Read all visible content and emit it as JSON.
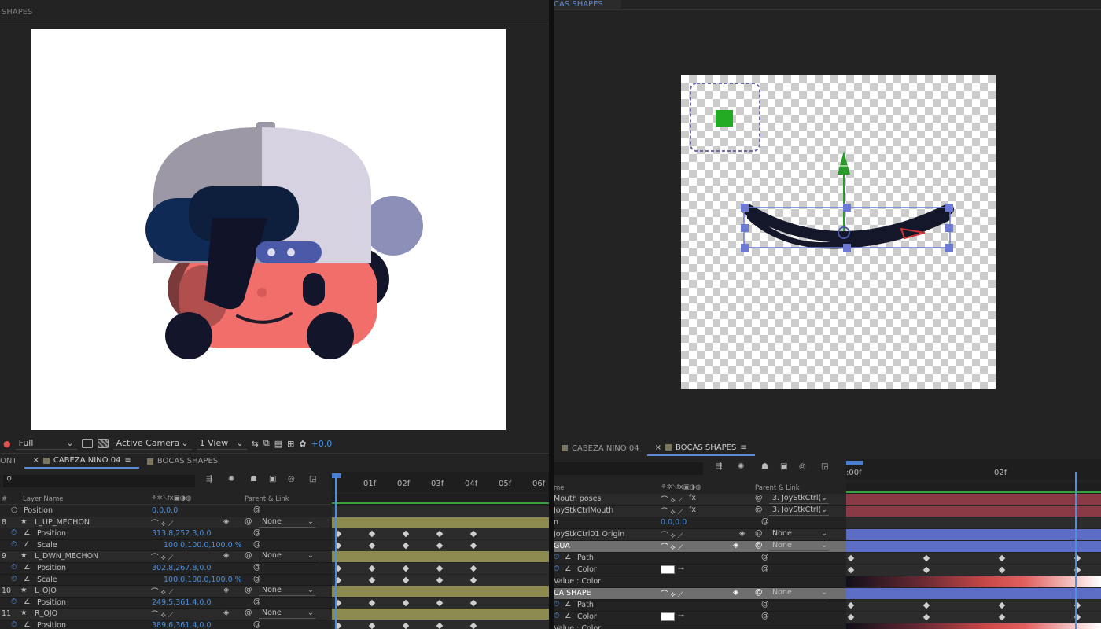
{
  "left_panel": {
    "title": "SHAPES",
    "viewer": {
      "resolution": "Full",
      "camera": "Active Camera",
      "views": "1 View",
      "exposure": "+0.0"
    },
    "tabs": [
      {
        "label": "ONT"
      },
      {
        "label": "CABEZA NINO 04"
      },
      {
        "label": "BOCAS SHAPES"
      }
    ],
    "search_placeholder": "",
    "headers": {
      "num": "#",
      "layer_name": "Layer Name",
      "parent": "Parent & Link"
    },
    "ruler": [
      "01f",
      "02f",
      "03f",
      "04f",
      "05f",
      "06f"
    ],
    "rows": [
      {
        "num": "",
        "name": "Position",
        "value": "0.0,0.0",
        "parent": "",
        "type": "prop"
      },
      {
        "num": "8",
        "name": "L_UP_MECHON",
        "value": "",
        "parent": "None",
        "type": "layer"
      },
      {
        "num": "",
        "name": "Position",
        "value": "313.8,252.3,0.0",
        "parent": "",
        "type": "prop"
      },
      {
        "num": "",
        "name": "Scale",
        "value": "100.0,100.0,100.0 %",
        "parent": "",
        "type": "prop"
      },
      {
        "num": "9",
        "name": "L_DWN_MECHON",
        "value": "",
        "parent": "None",
        "type": "layer"
      },
      {
        "num": "",
        "name": "Position",
        "value": "302.8,267.8,0.0",
        "parent": "",
        "type": "prop"
      },
      {
        "num": "",
        "name": "Scale",
        "value": "100.0,100.0,100.0 %",
        "parent": "",
        "type": "prop"
      },
      {
        "num": "10",
        "name": "L_OJO",
        "value": "",
        "parent": "None",
        "type": "layer"
      },
      {
        "num": "",
        "name": "Position",
        "value": "249.5,361.4,0.0",
        "parent": "",
        "type": "prop"
      },
      {
        "num": "11",
        "name": "R_OJO",
        "value": "",
        "parent": "None",
        "type": "layer"
      },
      {
        "num": "",
        "name": "Position",
        "value": "389.6,361.4,0.0",
        "parent": "",
        "type": "prop"
      }
    ]
  },
  "right_panel": {
    "title": "CAS SHAPES",
    "tabs": [
      {
        "label": "CABEZA NINO 04"
      },
      {
        "label": "BOCAS SHAPES"
      }
    ],
    "headers": {
      "name": "me",
      "parent": "Parent & Link"
    },
    "ruler": [
      ":00f",
      "02f"
    ],
    "rows": [
      {
        "name": "Mouth poses",
        "value": "",
        "parent": "3. JoyStkCtrl(",
        "type": "layer"
      },
      {
        "name": "JoyStkCtrlMouth",
        "value": "",
        "parent": "3. JoyStkCtrl(",
        "type": "layer"
      },
      {
        "name": "n",
        "value": "0.0,0.0",
        "parent": "",
        "type": "prop"
      },
      {
        "name": "JoyStkCtrl01 Origin",
        "value": "",
        "parent": "None",
        "type": "layer"
      },
      {
        "name": "GUA",
        "value": "",
        "parent": "None",
        "type": "layer-sel"
      },
      {
        "name": "Path",
        "value": "",
        "parent": "",
        "type": "prop"
      },
      {
        "name": "Color",
        "value": "",
        "parent": "",
        "type": "prop-color"
      },
      {
        "name": "Value : Color",
        "value": "",
        "parent": "",
        "type": "sub"
      },
      {
        "name": "CA SHAPE",
        "value": "",
        "parent": "None",
        "type": "layer-sel"
      },
      {
        "name": "Path",
        "value": "",
        "parent": "",
        "type": "prop"
      },
      {
        "name": "Color",
        "value": "",
        "parent": "",
        "type": "prop-color"
      },
      {
        "name": "Value : Color",
        "value": "",
        "parent": "",
        "type": "sub"
      }
    ]
  },
  "colors": {
    "accent": "#4a8fe0",
    "layer_bar": "#8c8a4e",
    "shape_bar": "#5b6dc4",
    "mouth_bar": "#8a3a44"
  }
}
